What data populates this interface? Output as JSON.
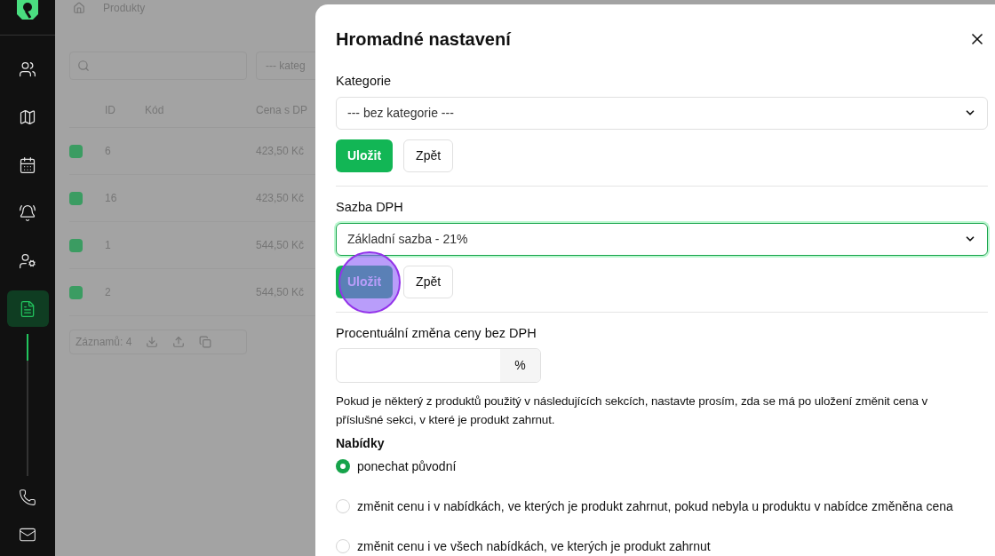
{
  "sidebar": {
    "items": [
      {
        "selected": false
      },
      {
        "selected": false
      },
      {
        "selected": false
      },
      {
        "selected": false
      },
      {
        "selected": false
      },
      {
        "selected": true
      }
    ]
  },
  "background": {
    "breadcrumb": "Produkty",
    "category_filter": "--- kateg",
    "columns": [
      "ID",
      "Kód",
      "Cena s DP"
    ],
    "rows": [
      {
        "checked": true,
        "id": "6",
        "price": "423,50 Kč"
      },
      {
        "checked": true,
        "id": "16",
        "price": "423,50 Kč"
      },
      {
        "checked": true,
        "id": "1",
        "price": "544,50 Kč"
      },
      {
        "checked": true,
        "id": "2",
        "price": "544,50 Kč"
      }
    ],
    "footer": "Záznamů: 4"
  },
  "dialog": {
    "title": "Hromadné nastavení",
    "sections": [
      {
        "kind": "select",
        "label": "Kategorie",
        "value": "--- bez kategorie ---",
        "focused": false,
        "buttons": [
          "Uložit",
          "Zpět"
        ]
      },
      {
        "kind": "select",
        "label": "Sazba DPH",
        "value": "Základní sazba - 21%",
        "focused": true,
        "buttons": [
          "Uložit",
          "Zpět"
        ],
        "clicked": true
      },
      {
        "kind": "percent",
        "label": "Procentuální změna ceny bez DPH",
        "suffix": "%"
      }
    ],
    "note": "Pokud je některý z produktů použitý v následujících sekcích, nastavte prosím, zda se má po uložení změnit cena v příslušné sekci, v které je produkt zahrnut.",
    "group": {
      "title": "Nabídky",
      "options": [
        {
          "label": "ponechat původní",
          "selected": true
        },
        {
          "label": "změnit cenu i v nabídkách, ve kterých je produkt zahrnut, pokud nebyla u produktu v nabídce změněna cena",
          "selected": false
        },
        {
          "label": "změnit cenu i ve všech nabídkách, ve kterých je produkt zahrnut",
          "selected": false
        }
      ]
    }
  }
}
